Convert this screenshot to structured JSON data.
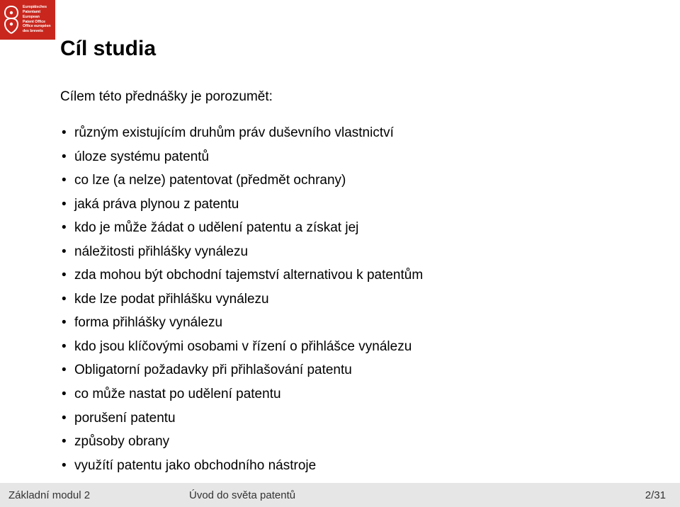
{
  "logo": {
    "lines": [
      "Europäisches",
      "Patentamt",
      "European",
      "Patent Office",
      "Office européen",
      "des brevets"
    ]
  },
  "title": "Cíl studia",
  "intro": "Cílem této přednášky je porozumět:",
  "bullets": [
    "různým existujícím druhům práv duševního vlastnictví",
    "úloze systému patentů",
    "co lze (a nelze) patentovat (předmět ochrany)",
    "jaká práva plynou z patentu",
    "kdo je může žádat o udělení patentu a získat jej",
    "náležitosti přihlášky vynálezu",
    "zda mohou být obchodní tajemství alternativou k patentům",
    "kde lze podat přihlášku vynálezu",
    "forma přihlášky vynálezu",
    "kdo jsou klíčovými osobami v řízení o přihlášce vynálezu",
    "Obligatorní požadavky při přihlašování patentu",
    "co může nastat po udělení patentu",
    "porušení patentu",
    "způsoby obrany",
    "využítí patentu jako obchodního nástroje"
  ],
  "footer": {
    "module": "Základní modul 2",
    "title": "Úvod do světa patentů",
    "page": "2/31"
  }
}
